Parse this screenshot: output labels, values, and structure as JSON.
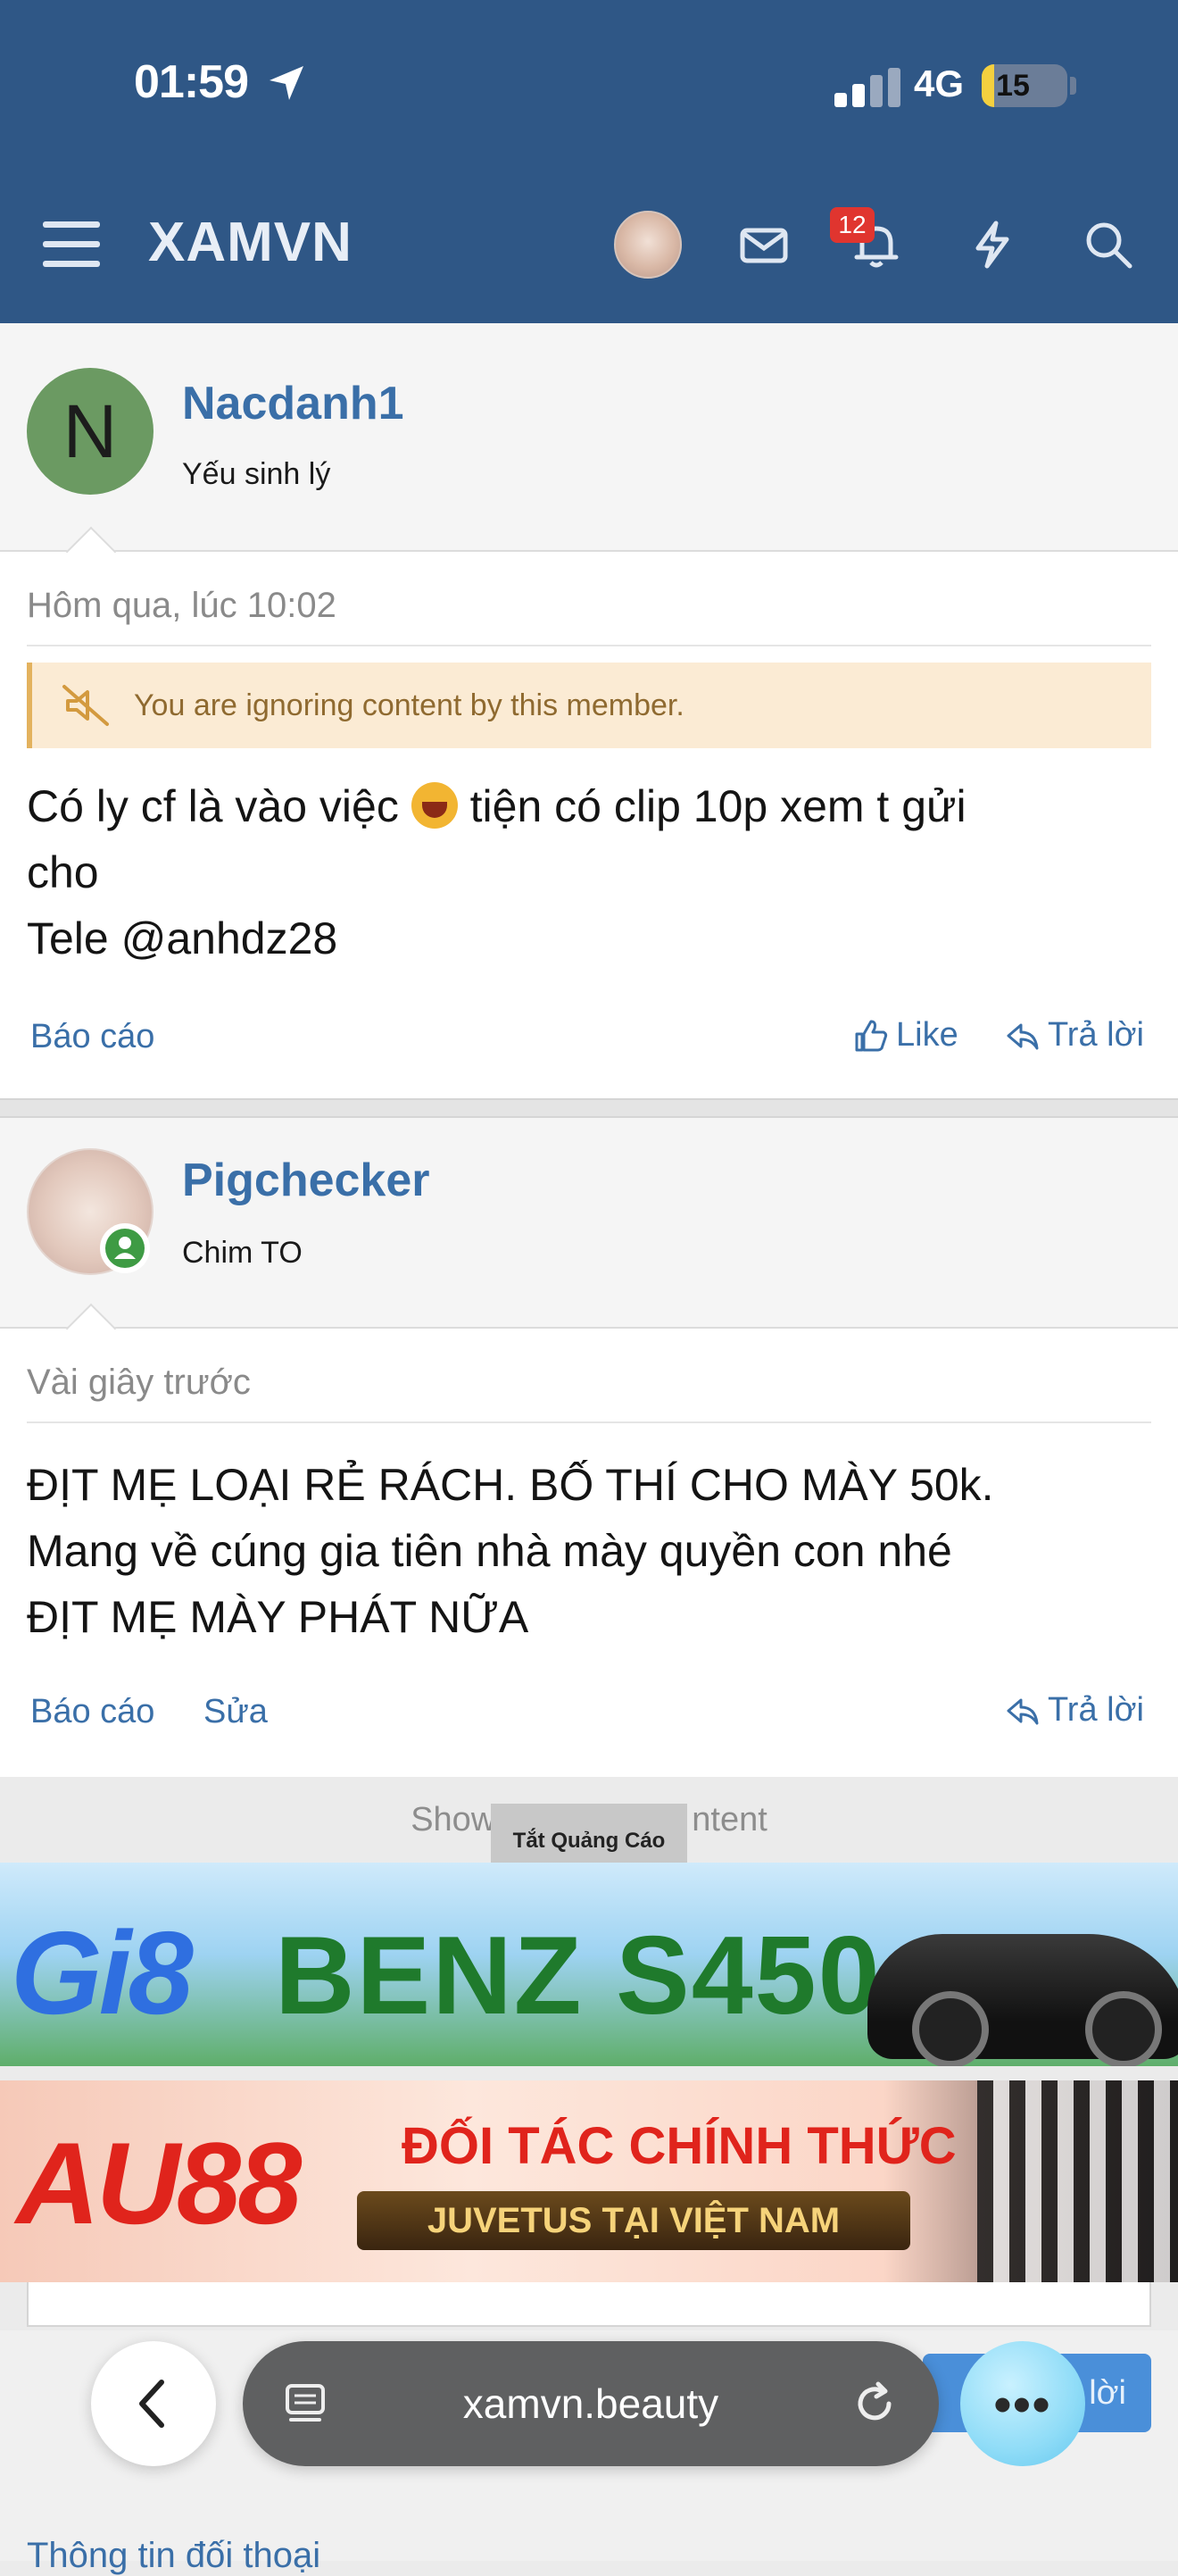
{
  "status_bar": {
    "time": "01:59",
    "network": "4G",
    "battery": "15",
    "battery_level": 0.15
  },
  "header": {
    "title": "XAMVN",
    "notification_count": "12",
    "icons": [
      "menu-icon",
      "avatar",
      "mail-icon",
      "bell-icon",
      "lightning-icon",
      "search-icon"
    ]
  },
  "posts": [
    {
      "username": "Nacdanh1",
      "user_title": "Yếu sinh lý",
      "avatar_letter": "N",
      "date": "Hôm qua, lúc 10:02",
      "ignore_notice": "You are ignoring content by this member.",
      "body_line1_a": "Có ly cf là vào việc",
      "body_line1_b": "tiện có clip 10p xem t gửi",
      "body_line2": "cho",
      "body_line3": "Tele @anhdz28",
      "actions": {
        "report": "Báo cáo",
        "like": "Like",
        "reply": "Trả lời"
      }
    },
    {
      "username": "Pigchecker",
      "user_title": "Chim TO",
      "date": "Vài giây trước",
      "body_line1": "ĐỊT MẸ LOẠI RẺ RÁCH. BỐ THÍ CHO MÀY 50k.",
      "body_line2": "Mang về cúng gia tiên nhà mày quyền con nhé",
      "body_line3": "ĐỊT MẸ MÀY PHÁT NỮA",
      "actions": {
        "report": "Báo cáo",
        "edit": "Sửa",
        "reply": "Trả lời"
      }
    }
  ],
  "ads": {
    "show_label_left": "Show",
    "show_label_right": "ntent",
    "close_ads_label": "Tắt Quảng Cáo",
    "ad1_logo": "Gi8",
    "ad1_text": "BENZ S450",
    "ad2_logo": "AU88",
    "ad2_title": "ĐỐI TÁC CHÍNH THỨC",
    "ad2_sub": "JUVETUS TẠI VIỆT NAM"
  },
  "browser": {
    "url": "xamvn.beauty",
    "post_reply_label": "Trả lời",
    "more_label": "•••"
  },
  "footer": {
    "link_text": "Thông tin đối thoại"
  }
}
